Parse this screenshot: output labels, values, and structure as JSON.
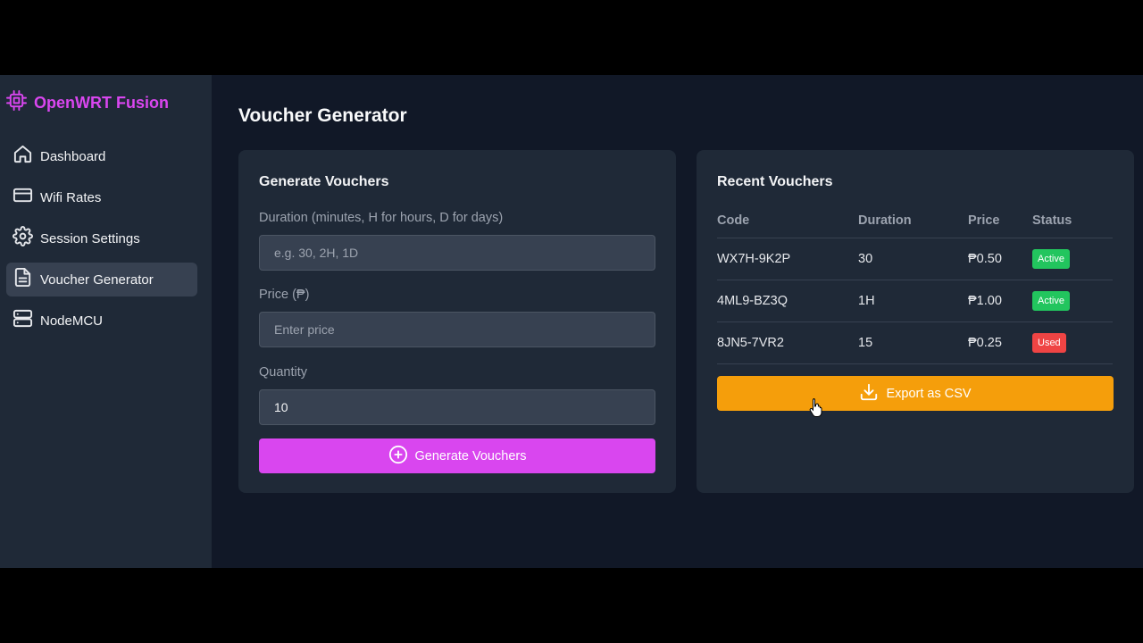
{
  "brand": {
    "name": "OpenWRT Fusion",
    "icon": "cpu-icon",
    "color": "#d946ef"
  },
  "nav": [
    {
      "label": "Dashboard",
      "icon": "home-icon",
      "active": false
    },
    {
      "label": "Wifi Rates",
      "icon": "credit-card-icon",
      "active": false
    },
    {
      "label": "Session Settings",
      "icon": "gear-icon",
      "active": false
    },
    {
      "label": "Voucher Generator",
      "icon": "document-icon",
      "active": true
    },
    {
      "label": "NodeMCU",
      "icon": "server-icon",
      "active": false
    }
  ],
  "page": {
    "title": "Voucher Generator"
  },
  "generate": {
    "title": "Generate Vouchers",
    "duration_label": "Duration (minutes, H for hours, D for days)",
    "duration_placeholder": "e.g. 30, 2H, 1D",
    "duration_value": "",
    "price_label": "Price (₱)",
    "price_placeholder": "Enter price",
    "price_value": "",
    "quantity_label": "Quantity",
    "quantity_value": "10",
    "button_label": "Generate Vouchers",
    "button_icon": "plus-circle-icon",
    "button_color": "#d946ef"
  },
  "recent": {
    "title": "Recent Vouchers",
    "headers": {
      "code": "Code",
      "duration": "Duration",
      "price": "Price",
      "status": "Status"
    },
    "rows": [
      {
        "code": "WX7H-9K2P",
        "duration": "30",
        "price": "₱0.50",
        "status": "Active"
      },
      {
        "code": "4ML9-BZ3Q",
        "duration": "1H",
        "price": "₱1.00",
        "status": "Active"
      },
      {
        "code": "8JN5-7VR2",
        "duration": "15",
        "price": "₱0.25",
        "status": "Used"
      }
    ],
    "export_label": "Export as CSV",
    "export_icon": "download-icon",
    "export_color": "#f59e0b",
    "status_colors": {
      "Active": "#22c55e",
      "Used": "#ef4444"
    }
  }
}
